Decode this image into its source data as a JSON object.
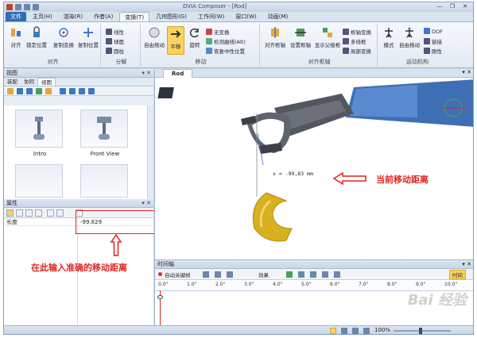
{
  "window": {
    "title": "DVIA Composer - [Rod]",
    "controls": [
      "—",
      "❐",
      "✕"
    ]
  },
  "tabs": [
    {
      "label": "文件"
    },
    {
      "label": "主页(H)"
    },
    {
      "label": "渲染(R)"
    },
    {
      "label": "作者(A)"
    },
    {
      "label": "变换(T)"
    },
    {
      "label": "几何图形(G)"
    },
    {
      "label": "工作间(W)"
    },
    {
      "label": "窗口(W)"
    },
    {
      "label": "动画(M)"
    }
  ],
  "ribbon": {
    "groups": {
      "align": "对齐",
      "distribute": "分解",
      "move": "移动",
      "align_pivot": "对齐枢轴",
      "motion": "运动机构"
    },
    "buttons": {
      "align": "对齐",
      "lock_pos": "锁定位置",
      "copy_transform": "复制变换",
      "copy_pos": "复制位置",
      "linear": "线性",
      "spherical": "球面",
      "cylinder": "圆柱",
      "free_drag": "自由拖动",
      "translate": "平移",
      "rotate": "旋转",
      "no_transform": "无变换",
      "detect_curve": "检测曲线(Alt)",
      "restore_pivot": "恢复中性位置",
      "align_pivot": "对齐枢轴",
      "set_pivot": "设置枢轴",
      "show_parent_pivot": "显示父级枢",
      "pivot_transform": "枢轴变换",
      "multi_frame": "多线框",
      "local_transform": "局部变换",
      "mode": "模式",
      "free_drag2": "自由拖动",
      "dof": "DOF",
      "link": "链接",
      "rigid": "刚性"
    }
  },
  "left_pane": {
    "views_title": "视图",
    "subtabs": [
      "装配",
      "协同",
      "视图"
    ],
    "thumbs": [
      {
        "caption": "Intro"
      },
      {
        "caption": "Front View"
      }
    ],
    "props_title": "属性",
    "prop_rows": [
      {
        "key": "长度",
        "value": "-99.829"
      }
    ]
  },
  "viewport": {
    "tab": "Rod",
    "measure_label": "x = -99,83 mm"
  },
  "annotations": {
    "current_distance": "当前移动距离",
    "input_hint": "在此输入准确的移动距离"
  },
  "timeline": {
    "title": "时间轴",
    "auto_key": "自动关键帧",
    "effects": "效果",
    "time_btn": "时间",
    "ticks": [
      "0.0\"",
      "1.0\"",
      "2.0\"",
      "3.0\"",
      "4.0\"",
      "5.0\"",
      "6.0\"",
      "7.0\"",
      "8.0\"",
      "9.0\"",
      "10.0\""
    ]
  },
  "statusbar": {
    "zoom": "100%"
  },
  "watermark": "Bai 经验",
  "colors": {
    "accent_red": "#e0241f",
    "file_tab": "#2f6db6",
    "highlight": "#fbd35b"
  }
}
